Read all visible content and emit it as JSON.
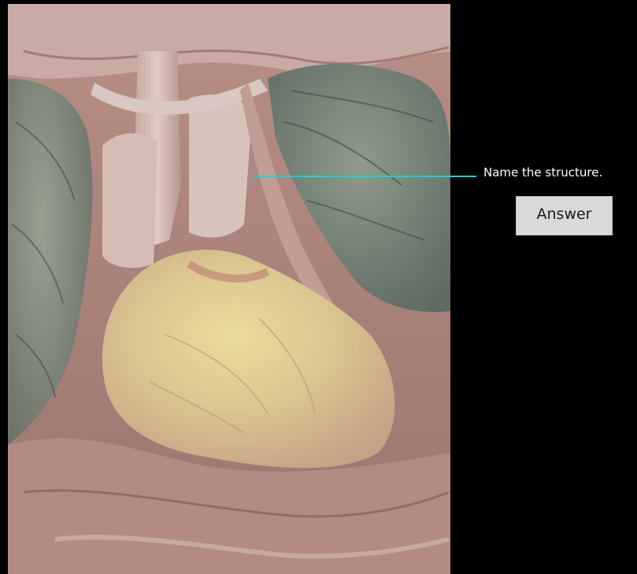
{
  "question": {
    "prompt": "Name the structure."
  },
  "answer_button": {
    "label": "Answer"
  },
  "colors": {
    "background": "#000000",
    "pointer_line": "#19d3d6",
    "button_bg": "#d9d9d9"
  }
}
